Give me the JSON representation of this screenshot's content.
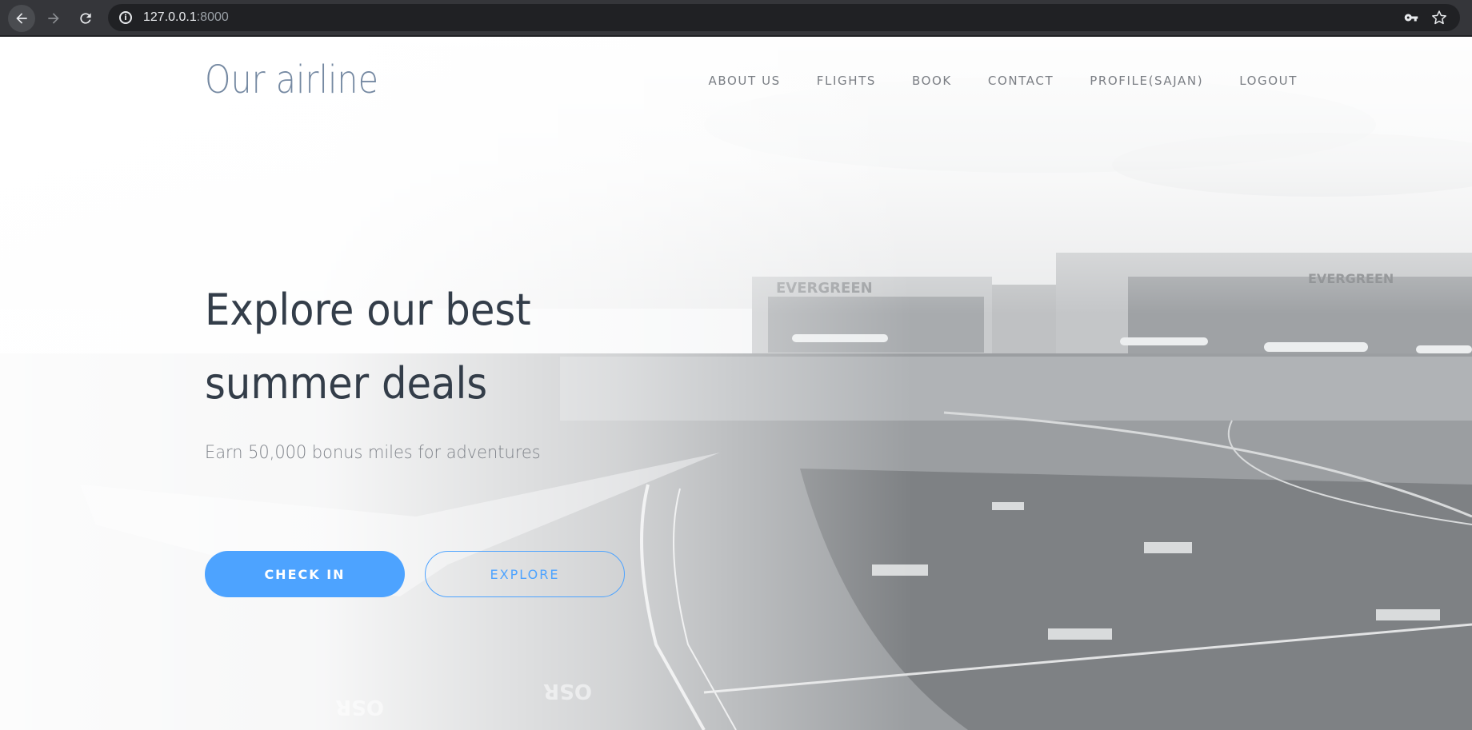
{
  "browser": {
    "url_host": "127.0.0.1",
    "url_port": ":8000",
    "icons": [
      "back-arrow-icon",
      "forward-arrow-icon",
      "reload-icon",
      "info-icon",
      "key-icon",
      "star-icon"
    ]
  },
  "header": {
    "logo": "Our airline",
    "nav": [
      {
        "label": "ABOUT US"
      },
      {
        "label": "FLIGHTS"
      },
      {
        "label": "BOOK"
      },
      {
        "label": "CONTACT"
      },
      {
        "label": "PROFILE(SAJAN)"
      },
      {
        "label": "LOGOUT"
      }
    ]
  },
  "hero": {
    "title": "Explore our best summer deals",
    "subtitle": "Earn 50,000 bonus miles for adventures",
    "primary_button": "CHECK IN",
    "secondary_button": "EXPLORE"
  },
  "colors": {
    "accent": "#4da3ff",
    "logo": "#7589a2",
    "title": "#333d49",
    "nav_text": "#7a7e84",
    "chrome_bg": "#35363a",
    "omnibox_bg": "#202124"
  }
}
